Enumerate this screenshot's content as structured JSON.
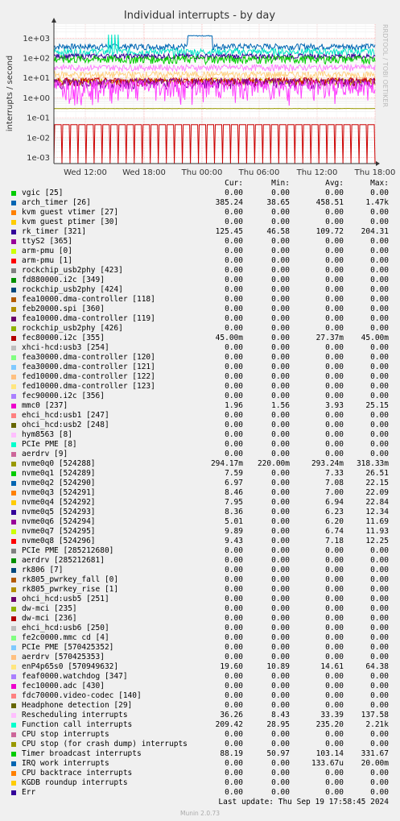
{
  "chart_data": {
    "type": "line",
    "title": "Individual interrupts - by day",
    "ylabel": "interrupts / second",
    "y_scale": "log",
    "ylim": [
      0.0005,
      5000
    ],
    "y_ticks": [
      "1e-03",
      "1e-02",
      "1e-01",
      "1e+00",
      "1e+01",
      "1e+02",
      "1e+03"
    ],
    "x_ticks": [
      "Wed 12:00",
      "Wed 18:00",
      "Thu 00:00",
      "Thu 06:00",
      "Thu 12:00",
      "Thu 18:00"
    ],
    "grid": true,
    "vendor": "RRDTOOL / TOBI OETIKER",
    "series": [
      {
        "name": "arch_timer [26]",
        "color": "#0066b3",
        "base": 385,
        "spread": 0.35,
        "high_window": [
          2.92,
          3.45,
          1300
        ]
      },
      {
        "name": "Function call interrupts",
        "color": "#00e6c8",
        "base": 210,
        "spread": 0.4,
        "spikes": [
          1.6,
          2.1,
          1500
        ]
      },
      {
        "name": "rk_timer [321]",
        "color": "#330099",
        "base": 125,
        "spread": 0.3
      },
      {
        "name": "Timer broadcast interrupts",
        "color": "#00cc00",
        "base": 90,
        "spread": 0.45
      },
      {
        "name": "Rescheduling interrupts",
        "color": "#ff80ff",
        "base": 34,
        "spread": 0.35
      },
      {
        "name": "enP4p65s0 [570949632]",
        "color": "#ffd080",
        "base": 15,
        "spread": 0.4
      },
      {
        "name": "nvme0q5 [524293]",
        "color": "#ccaa00",
        "base": 7,
        "spread": 0.4
      },
      {
        "name": "nvme0q1 [524289]",
        "color": "#cc0000",
        "base": 7,
        "spread": 0.45
      },
      {
        "name": "nvme0q6 [524294]",
        "color": "#8000a0",
        "base": 6,
        "spread": 0.55
      },
      {
        "name": "mmc0 [237]",
        "color": "#ff40ff",
        "base": 4,
        "spread": 0.9
      },
      {
        "name": "nvme0q0 [524288]",
        "color": "#999900",
        "base": 0.29,
        "spread": 0.02
      },
      {
        "name": "fec80000.i2c [355]",
        "color": "#cc0000",
        "base": 0.045,
        "spread": 0.0,
        "sawtooth": true
      },
      {
        "name": "IRQ work interrupts",
        "color": "#0066b3",
        "base": 0.0001,
        "spread": 0.0
      }
    ]
  },
  "legend": {
    "headers": {
      "cur": "Cur:",
      "min": "Min:",
      "avg": "Avg:",
      "max": "Max:"
    },
    "rows": [
      {
        "name": "vgic [25]",
        "color": "#00cc00",
        "cur": "0.00",
        "min": "0.00",
        "avg": "0.00",
        "max": "0.00"
      },
      {
        "name": "arch_timer [26]",
        "color": "#0066b3",
        "cur": "385.24",
        "min": "38.65",
        "avg": "458.51",
        "max": "1.47k"
      },
      {
        "name": "kvm guest vtimer [27]",
        "color": "#ff8000",
        "cur": "0.00",
        "min": "0.00",
        "avg": "0.00",
        "max": "0.00"
      },
      {
        "name": "kvm guest ptimer [30]",
        "color": "#ffcc00",
        "cur": "0.00",
        "min": "0.00",
        "avg": "0.00",
        "max": "0.00"
      },
      {
        "name": "rk_timer [321]",
        "color": "#330099",
        "cur": "125.45",
        "min": "46.58",
        "avg": "109.72",
        "max": "204.31"
      },
      {
        "name": "ttyS2 [365]",
        "color": "#990099",
        "cur": "0.00",
        "min": "0.00",
        "avg": "0.00",
        "max": "0.00"
      },
      {
        "name": "arm-pmu [0]",
        "color": "#ccff00",
        "cur": "0.00",
        "min": "0.00",
        "avg": "0.00",
        "max": "0.00"
      },
      {
        "name": "arm-pmu [1]",
        "color": "#ff0000",
        "cur": "0.00",
        "min": "0.00",
        "avg": "0.00",
        "max": "0.00"
      },
      {
        "name": "rockchip_usb2phy [423]",
        "color": "#808080",
        "cur": "0.00",
        "min": "0.00",
        "avg": "0.00",
        "max": "0.00"
      },
      {
        "name": "fd880000.i2c [349]",
        "color": "#008f00",
        "cur": "0.00",
        "min": "0.00",
        "avg": "0.00",
        "max": "0.00"
      },
      {
        "name": "rockchip_usb2phy [424]",
        "color": "#00487d",
        "cur": "0.00",
        "min": "0.00",
        "avg": "0.00",
        "max": "0.00"
      },
      {
        "name": "fea10000.dma-controller [118]",
        "color": "#b35a00",
        "cur": "0.00",
        "min": "0.00",
        "avg": "0.00",
        "max": "0.00"
      },
      {
        "name": "feb20000.spi [360]",
        "color": "#b38f00",
        "cur": "0.00",
        "min": "0.00",
        "avg": "0.00",
        "max": "0.00"
      },
      {
        "name": "fea10000.dma-controller [119]",
        "color": "#6b006b",
        "cur": "0.00",
        "min": "0.00",
        "avg": "0.00",
        "max": "0.00"
      },
      {
        "name": "rockchip_usb2phy [426]",
        "color": "#8fb300",
        "cur": "0.00",
        "min": "0.00",
        "avg": "0.00",
        "max": "0.00"
      },
      {
        "name": "fec80000.i2c [355]",
        "color": "#b30000",
        "cur": "45.00m",
        "min": "0.00",
        "avg": "27.37m",
        "max": "45.00m"
      },
      {
        "name": "xhci-hcd:usb3 [254]",
        "color": "#bebebe",
        "cur": "0.00",
        "min": "0.00",
        "avg": "0.00",
        "max": "0.00"
      },
      {
        "name": "fea30000.dma-controller [120]",
        "color": "#80ff80",
        "cur": "0.00",
        "min": "0.00",
        "avg": "0.00",
        "max": "0.00"
      },
      {
        "name": "fea30000.dma-controller [121]",
        "color": "#80c9ff",
        "cur": "0.00",
        "min": "0.00",
        "avg": "0.00",
        "max": "0.00"
      },
      {
        "name": "fed10000.dma-controller [122]",
        "color": "#ffc080",
        "cur": "0.00",
        "min": "0.00",
        "avg": "0.00",
        "max": "0.00"
      },
      {
        "name": "fed10000.dma-controller [123]",
        "color": "#ffe680",
        "cur": "0.00",
        "min": "0.00",
        "avg": "0.00",
        "max": "0.00"
      },
      {
        "name": "fec90000.i2c [356]",
        "color": "#aa80ff",
        "cur": "0.00",
        "min": "0.00",
        "avg": "0.00",
        "max": "0.00"
      },
      {
        "name": "mmc0 [237]",
        "color": "#ee00cc",
        "cur": "1.96",
        "min": "1.56",
        "avg": "3.93",
        "max": "25.15"
      },
      {
        "name": "ehci_hcd:usb1 [247]",
        "color": "#ff8080",
        "cur": "0.00",
        "min": "0.00",
        "avg": "0.00",
        "max": "0.00"
      },
      {
        "name": "ohci_hcd:usb2 [248]",
        "color": "#666600",
        "cur": "0.00",
        "min": "0.00",
        "avg": "0.00",
        "max": "0.00"
      },
      {
        "name": "hym8563 [8]",
        "color": "#ffbfff",
        "cur": "0.00",
        "min": "0.00",
        "avg": "0.00",
        "max": "0.00"
      },
      {
        "name": "PCIe PME [8]",
        "color": "#00ffcc",
        "cur": "0.00",
        "min": "0.00",
        "avg": "0.00",
        "max": "0.00"
      },
      {
        "name": "aerdrv [9]",
        "color": "#cc6699",
        "cur": "0.00",
        "min": "0.00",
        "avg": "0.00",
        "max": "0.00"
      },
      {
        "name": "nvme0q0 [524288]",
        "color": "#999900",
        "cur": "294.17m",
        "min": "220.00m",
        "avg": "293.24m",
        "max": "318.33m"
      },
      {
        "name": "nvme0q1 [524289]",
        "color": "#00cc00",
        "cur": "7.59",
        "min": "0.00",
        "avg": "7.33",
        "max": "26.51"
      },
      {
        "name": "nvme0q2 [524290]",
        "color": "#0066b3",
        "cur": "6.97",
        "min": "0.00",
        "avg": "7.08",
        "max": "22.15"
      },
      {
        "name": "nvme0q3 [524291]",
        "color": "#ff8000",
        "cur": "8.46",
        "min": "0.00",
        "avg": "7.00",
        "max": "22.09"
      },
      {
        "name": "nvme0q4 [524292]",
        "color": "#ffcc00",
        "cur": "7.95",
        "min": "0.00",
        "avg": "6.94",
        "max": "22.84"
      },
      {
        "name": "nvme0q5 [524293]",
        "color": "#330099",
        "cur": "8.36",
        "min": "0.00",
        "avg": "6.23",
        "max": "12.34"
      },
      {
        "name": "nvme0q6 [524294]",
        "color": "#990099",
        "cur": "5.01",
        "min": "0.00",
        "avg": "6.20",
        "max": "11.69"
      },
      {
        "name": "nvme0q7 [524295]",
        "color": "#ccff00",
        "cur": "9.89",
        "min": "0.00",
        "avg": "6.74",
        "max": "11.93"
      },
      {
        "name": "nvme0q8 [524296]",
        "color": "#ff0000",
        "cur": "9.43",
        "min": "0.00",
        "avg": "7.18",
        "max": "12.25"
      },
      {
        "name": "PCIe PME [285212680]",
        "color": "#808080",
        "cur": "0.00",
        "min": "0.00",
        "avg": "0.00",
        "max": "0.00"
      },
      {
        "name": "aerdrv [285212681]",
        "color": "#008f00",
        "cur": "0.00",
        "min": "0.00",
        "avg": "0.00",
        "max": "0.00"
      },
      {
        "name": "rk806 [7]",
        "color": "#00487d",
        "cur": "0.00",
        "min": "0.00",
        "avg": "0.00",
        "max": "0.00"
      },
      {
        "name": "rk805_pwrkey_fall [0]",
        "color": "#b35a00",
        "cur": "0.00",
        "min": "0.00",
        "avg": "0.00",
        "max": "0.00"
      },
      {
        "name": "rk805_pwrkey_rise [1]",
        "color": "#b38f00",
        "cur": "0.00",
        "min": "0.00",
        "avg": "0.00",
        "max": "0.00"
      },
      {
        "name": "ohci_hcd:usb5 [251]",
        "color": "#6b006b",
        "cur": "0.00",
        "min": "0.00",
        "avg": "0.00",
        "max": "0.00"
      },
      {
        "name": "dw-mci [235]",
        "color": "#8fb300",
        "cur": "0.00",
        "min": "0.00",
        "avg": "0.00",
        "max": "0.00"
      },
      {
        "name": "dw-mci [236]",
        "color": "#b30000",
        "cur": "0.00",
        "min": "0.00",
        "avg": "0.00",
        "max": "0.00"
      },
      {
        "name": "ehci_hcd:usb6 [250]",
        "color": "#bebebe",
        "cur": "0.00",
        "min": "0.00",
        "avg": "0.00",
        "max": "0.00"
      },
      {
        "name": "fe2c0000.mmc cd [4]",
        "color": "#80ff80",
        "cur": "0.00",
        "min": "0.00",
        "avg": "0.00",
        "max": "0.00"
      },
      {
        "name": "PCIe PME [570425352]",
        "color": "#80c9ff",
        "cur": "0.00",
        "min": "0.00",
        "avg": "0.00",
        "max": "0.00"
      },
      {
        "name": "aerdrv [570425353]",
        "color": "#ffc080",
        "cur": "0.00",
        "min": "0.00",
        "avg": "0.00",
        "max": "0.00"
      },
      {
        "name": "enP4p65s0 [570949632]",
        "color": "#ffe680",
        "cur": "19.60",
        "min": "10.89",
        "avg": "14.61",
        "max": "64.38"
      },
      {
        "name": "feaf0000.watchdog [347]",
        "color": "#aa80ff",
        "cur": "0.00",
        "min": "0.00",
        "avg": "0.00",
        "max": "0.00"
      },
      {
        "name": "fec10000.adc [430]",
        "color": "#ee00cc",
        "cur": "0.00",
        "min": "0.00",
        "avg": "0.00",
        "max": "0.00"
      },
      {
        "name": "fdc70000.video-codec [140]",
        "color": "#ff8080",
        "cur": "0.00",
        "min": "0.00",
        "avg": "0.00",
        "max": "0.00"
      },
      {
        "name": "Headphone detection [29]",
        "color": "#666600",
        "cur": "0.00",
        "min": "0.00",
        "avg": "0.00",
        "max": "0.00"
      },
      {
        "name": "Rescheduling interrupts",
        "color": "#ffbfff",
        "cur": "36.26",
        "min": "8.43",
        "avg": "33.39",
        "max": "137.58"
      },
      {
        "name": "Function call interrupts",
        "color": "#00ffcc",
        "cur": "209.42",
        "min": "28.95",
        "avg": "235.20",
        "max": "2.21k"
      },
      {
        "name": "CPU stop interrupts",
        "color": "#cc6699",
        "cur": "0.00",
        "min": "0.00",
        "avg": "0.00",
        "max": "0.00"
      },
      {
        "name": "CPU stop (for crash dump) interrupts",
        "color": "#999900",
        "cur": "0.00",
        "min": "0.00",
        "avg": "0.00",
        "max": "0.00"
      },
      {
        "name": "Timer broadcast interrupts",
        "color": "#00cc00",
        "cur": "88.19",
        "min": "50.97",
        "avg": "103.14",
        "max": "331.67"
      },
      {
        "name": "IRQ work interrupts",
        "color": "#0066b3",
        "cur": "0.00",
        "min": "0.00",
        "avg": "133.67u",
        "max": "20.00m"
      },
      {
        "name": "CPU backtrace interrupts",
        "color": "#ff8000",
        "cur": "0.00",
        "min": "0.00",
        "avg": "0.00",
        "max": "0.00"
      },
      {
        "name": "KGDB roundup interrupts",
        "color": "#ffcc00",
        "cur": "0.00",
        "min": "0.00",
        "avg": "0.00",
        "max": "0.00"
      },
      {
        "name": "Err",
        "color": "#330099",
        "cur": "0.00",
        "min": "0.00",
        "avg": "0.00",
        "max": "0.00"
      }
    ]
  },
  "footer": {
    "last_update": "Last update: Thu Sep 19 17:58:45 2024",
    "version": "Munin 2.0.73"
  }
}
